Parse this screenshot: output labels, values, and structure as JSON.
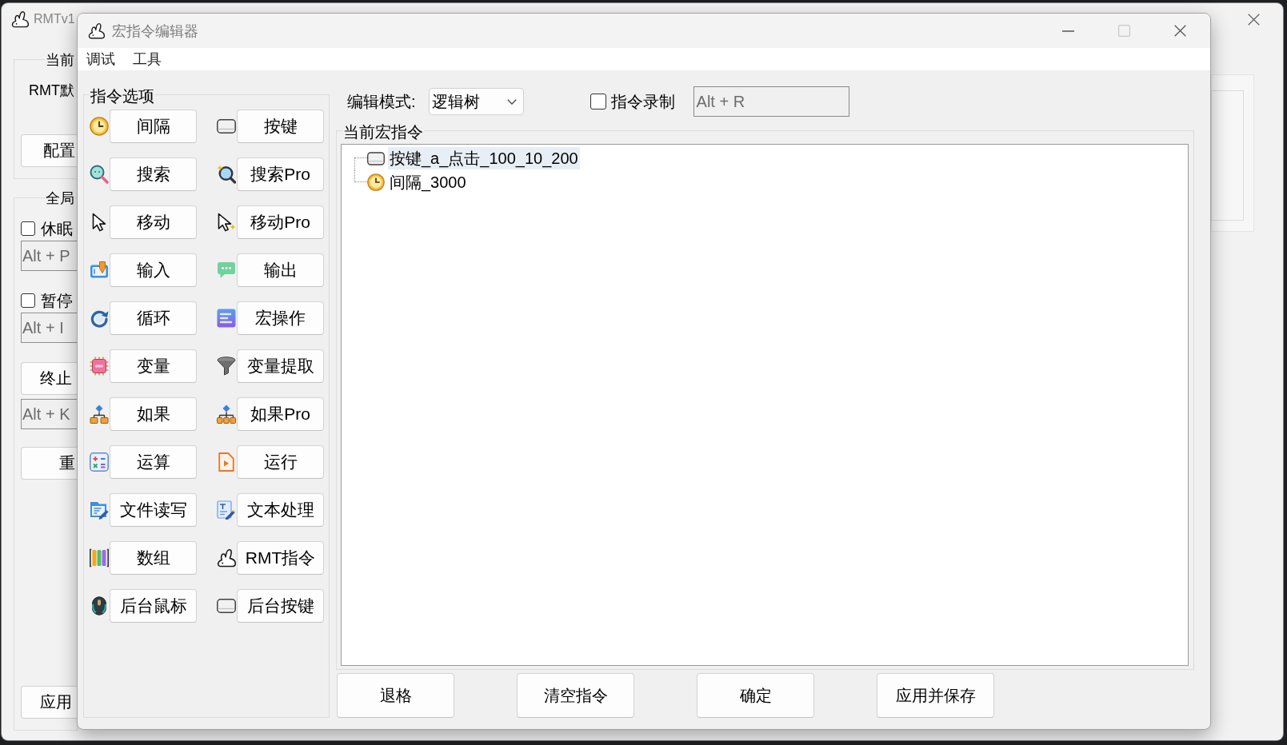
{
  "main_window": {
    "title": "RMTv1",
    "current_group": {
      "title": "当前",
      "profile": "RMT默",
      "config_button": "配置"
    },
    "global_group": {
      "title": "全局",
      "toggles": [
        {
          "label": "休眠",
          "checked": false,
          "hotkey": {
            "value": "Alt + P",
            "disabled": true
          }
        },
        {
          "label": "暂停",
          "checked": false,
          "hotkey": {
            "value": "Alt + I",
            "disabled": true
          }
        }
      ],
      "stop_button": "终止",
      "stop_hotkey": {
        "value": "Alt + K",
        "disabled": true
      },
      "button_2": "重",
      "apply_button": "应用"
    }
  },
  "dialog": {
    "title": "宏指令编辑器",
    "window_controls": [
      {
        "kind": "minimize",
        "disabled": false
      },
      {
        "kind": "maximize",
        "disabled": true
      },
      {
        "kind": "close",
        "disabled": false
      }
    ],
    "menu": [
      "调试",
      "工具"
    ],
    "command_options": {
      "title": "指令选项",
      "commands": [
        "间隔",
        "按键",
        "搜索",
        "搜索Pro",
        "移动",
        "移动Pro",
        "输入",
        "输出",
        "循环",
        "宏操作",
        "变量",
        "变量提取",
        "如果",
        "如果Pro",
        "运算",
        "运行",
        "文件读写",
        "文本处理",
        "数组",
        "RMT指令",
        "后台鼠标",
        "后台按键"
      ]
    },
    "edit_mode": {
      "label": "编辑模式:",
      "value": "逻辑树"
    },
    "record": {
      "label": "指令录制",
      "checked": false,
      "hotkey": {
        "value": "Alt + R",
        "disabled": true
      }
    },
    "current_macro": {
      "title": "当前宏指令",
      "items": [
        {
          "kind": "key",
          "label": "按键_a_点击_100_10_200",
          "selected": true
        },
        {
          "kind": "interval",
          "label": "间隔_3000",
          "selected": false
        }
      ]
    },
    "buttons": [
      "退格",
      "清空指令",
      "确定",
      "应用并保存"
    ]
  }
}
